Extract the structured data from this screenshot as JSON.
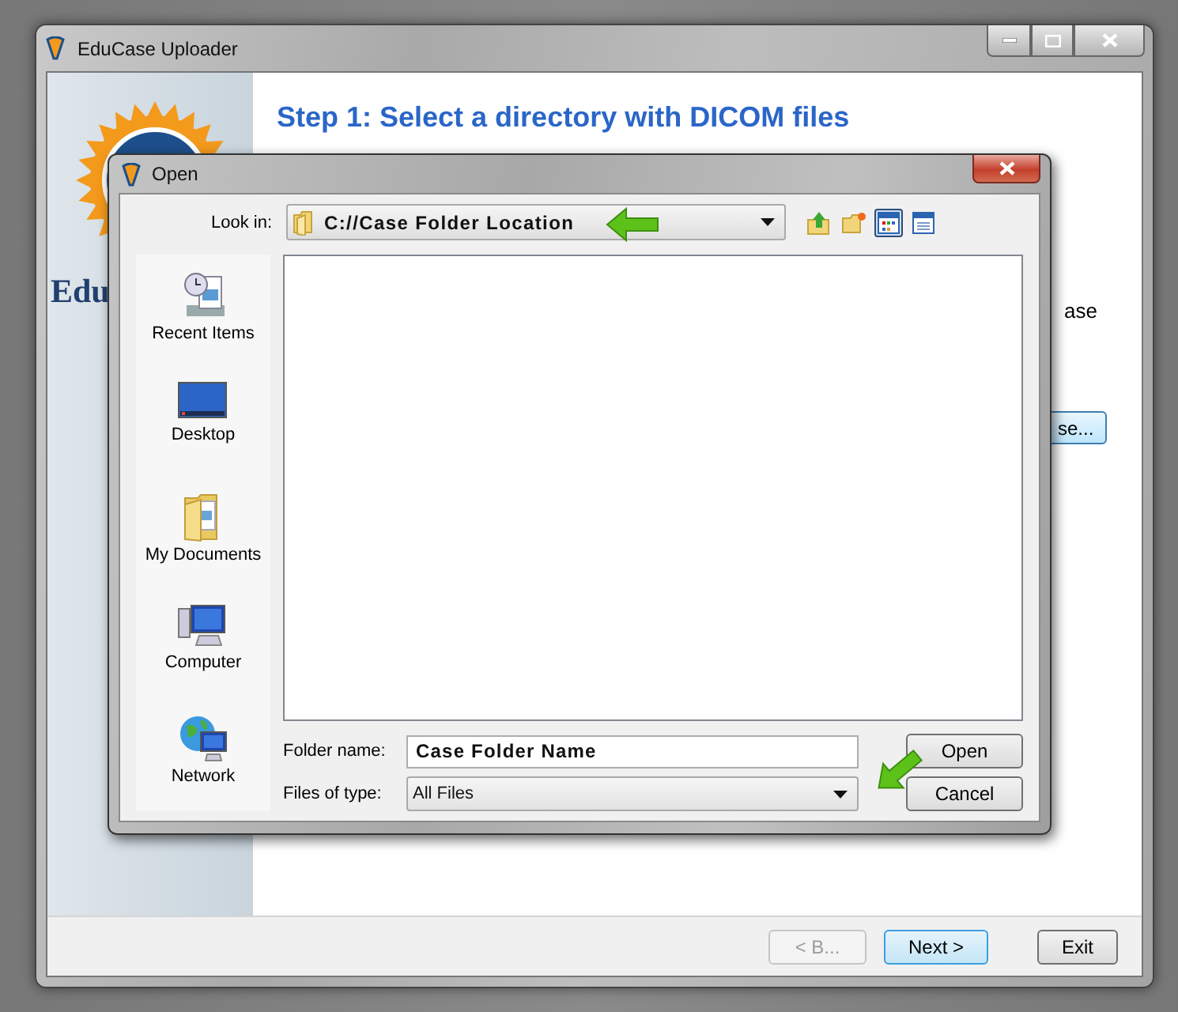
{
  "main_window": {
    "title": "EduCase Uploader",
    "logo_text": "Edu",
    "heading": "Step 1: Select a directory with DICOM files",
    "partial_text": "ase",
    "partial_button": "se...",
    "buttons": [
      {
        "label": "< B...",
        "disabled": true,
        "default": false
      },
      {
        "label": "Next >",
        "disabled": false,
        "default": true
      },
      {
        "label": "Exit",
        "disabled": false,
        "default": false
      }
    ]
  },
  "dialog": {
    "title": "Open",
    "look_in": {
      "label": "Look in:",
      "value": "C://Case Folder Location"
    },
    "tools": [
      {
        "kind": "up",
        "selected": false
      },
      {
        "kind": "new_folder",
        "selected": false
      },
      {
        "kind": "list",
        "selected": true
      },
      {
        "kind": "details",
        "selected": false
      }
    ],
    "places": [
      {
        "kind": "recent",
        "label": "Recent Items"
      },
      {
        "kind": "desktop",
        "label": "Desktop"
      },
      {
        "kind": "documents",
        "label": "My Documents"
      },
      {
        "kind": "computer",
        "label": "Computer"
      },
      {
        "kind": "network",
        "label": "Network"
      }
    ],
    "folder_name": {
      "label": "Folder name:",
      "value": "Case Folder Name"
    },
    "files_of_type": {
      "label": "Files of type:",
      "value": "All Files"
    },
    "buttons": [
      {
        "label": "Open"
      },
      {
        "label": "Cancel"
      }
    ]
  }
}
